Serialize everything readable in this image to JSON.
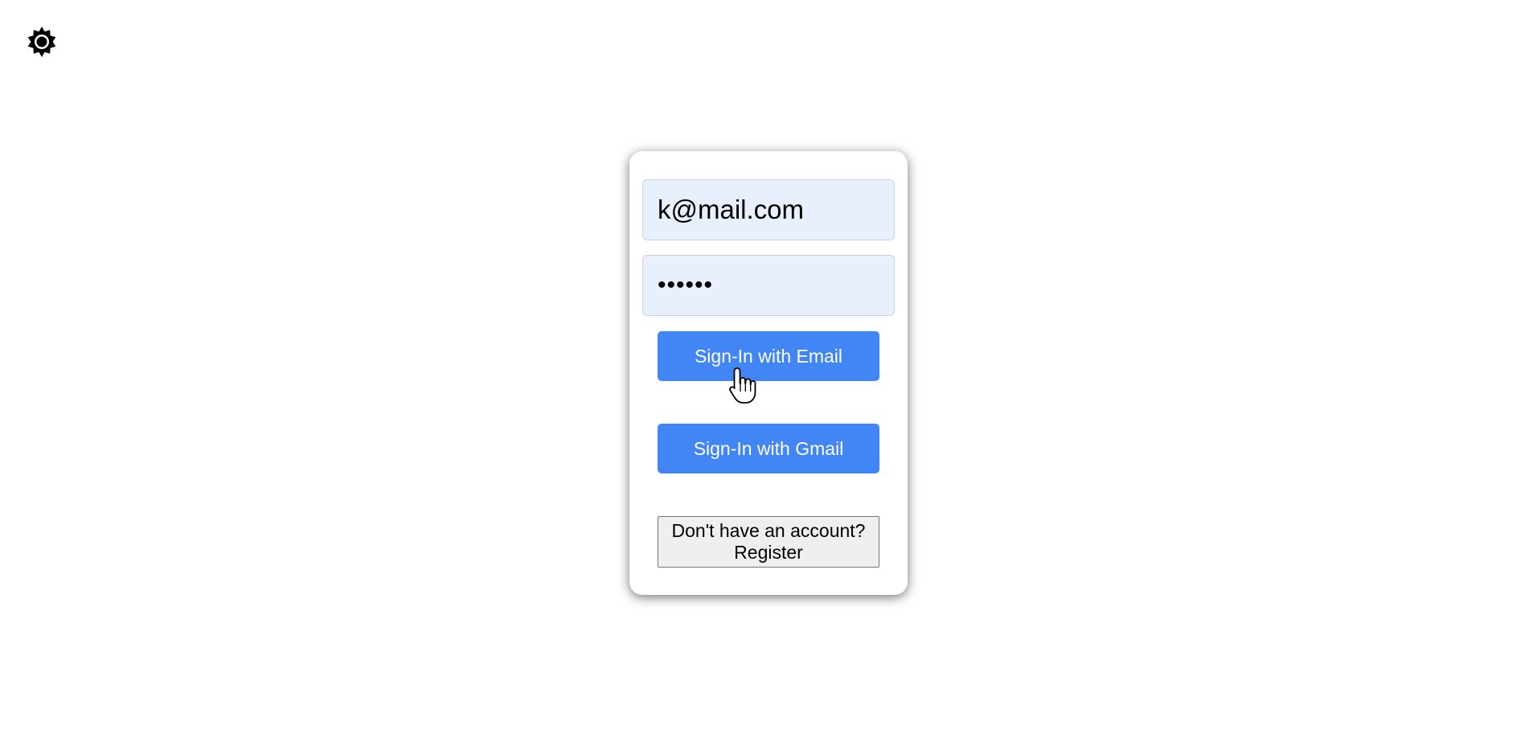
{
  "header": {
    "settings_icon": "gear-icon"
  },
  "login_form": {
    "email_value": "k@mail.com",
    "password_value": "••••••",
    "sign_in_email_label": "Sign-In with Email",
    "sign_in_gmail_label": "Sign-In with Gmail",
    "register_label": "Don't have an account? Register"
  },
  "colors": {
    "primary_button": "#4285f4",
    "input_background": "#e8f0fe"
  }
}
